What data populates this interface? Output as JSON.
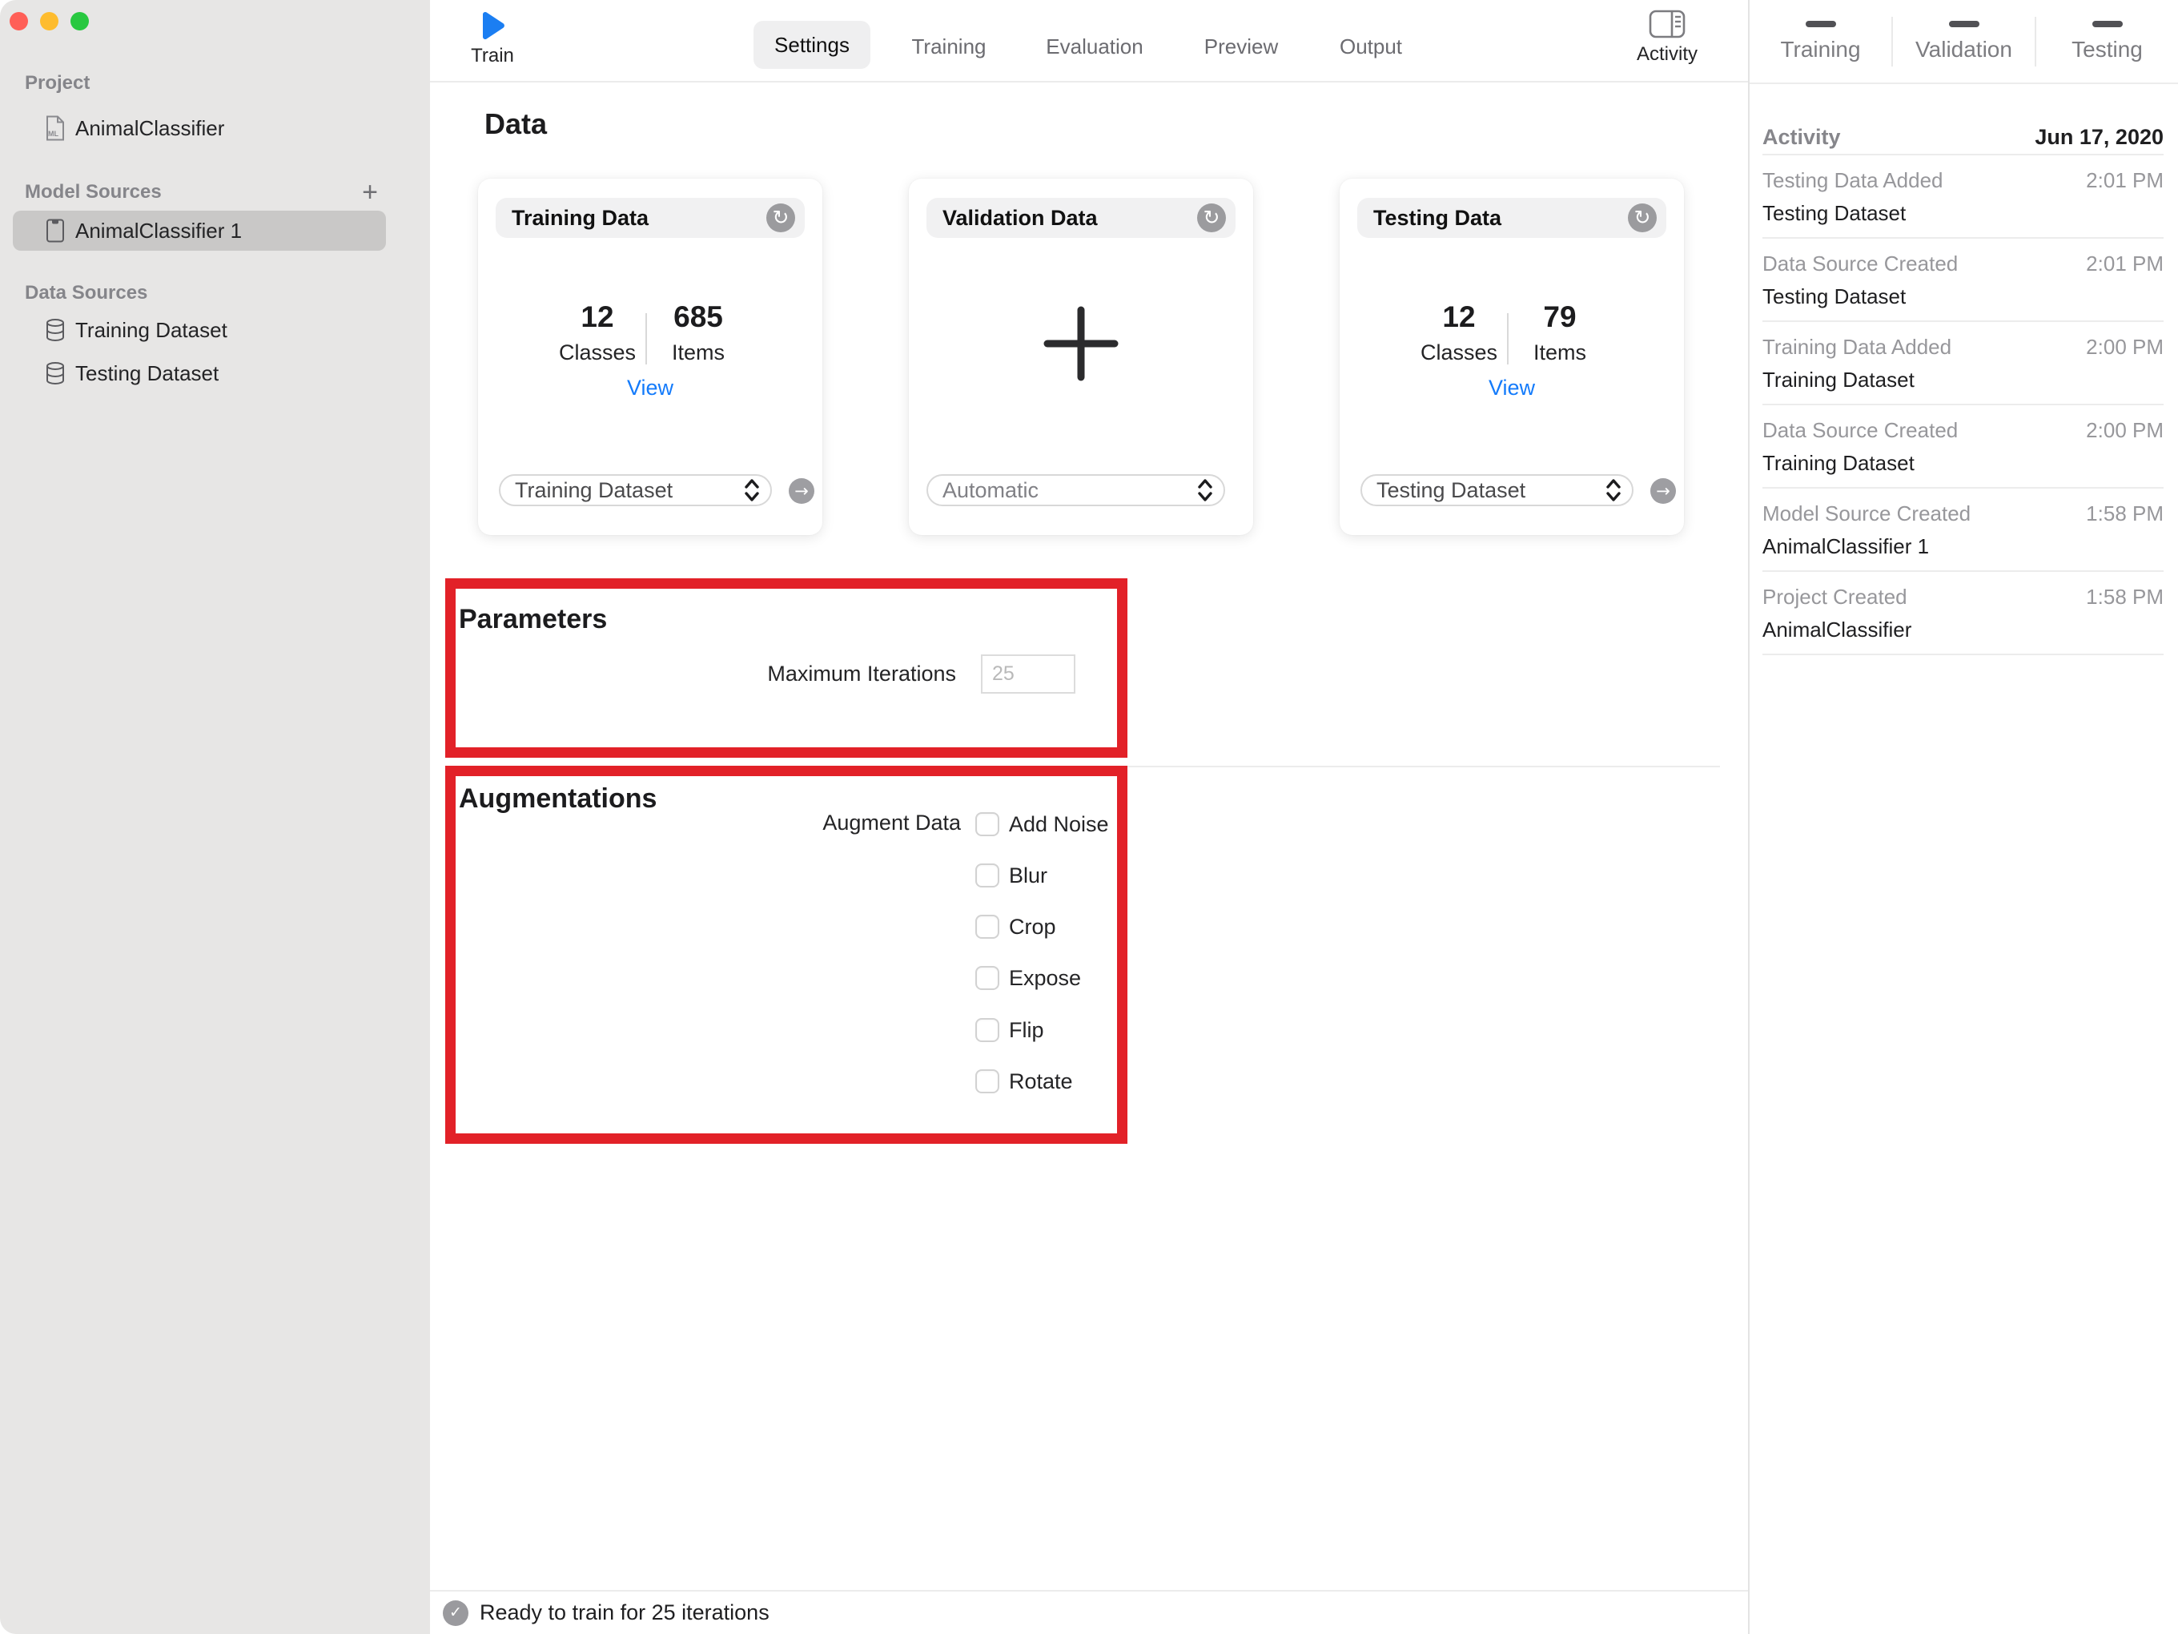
{
  "window": {
    "traffic_lights": [
      "close",
      "minimize",
      "zoom"
    ]
  },
  "sidebar": {
    "project_label": "Project",
    "project_item": "AnimalClassifier",
    "model_sources_label": "Model Sources",
    "add_button": "+",
    "model_source_item": "AnimalClassifier 1",
    "data_sources_label": "Data Sources",
    "data_source_items": [
      "Training Dataset",
      "Testing Dataset"
    ]
  },
  "toolbar": {
    "train_label": "Train",
    "tabs": [
      "Settings",
      "Training",
      "Evaluation",
      "Preview",
      "Output"
    ],
    "selected_tab": "Settings",
    "activity_label": "Activity"
  },
  "main": {
    "heading": "Data",
    "cards": {
      "training": {
        "title": "Training Data",
        "classes_value": "12",
        "classes_label": "Classes",
        "items_value": "685",
        "items_label": "Items",
        "view_label": "View",
        "dropdown_value": "Training Dataset"
      },
      "validation": {
        "title": "Validation Data",
        "dropdown_value": "Automatic"
      },
      "testing": {
        "title": "Testing Data",
        "classes_value": "12",
        "classes_label": "Classes",
        "items_value": "79",
        "items_label": "Items",
        "view_label": "View",
        "dropdown_value": "Testing Dataset"
      }
    },
    "parameters": {
      "heading": "Parameters",
      "max_iterations_label": "Maximum Iterations",
      "max_iterations_value": "25"
    },
    "augmentations": {
      "heading": "Augmentations",
      "augment_data_label": "Augment Data",
      "options": [
        "Add Noise",
        "Blur",
        "Crop",
        "Expose",
        "Flip",
        "Rotate"
      ]
    },
    "status_bar": {
      "text": "Ready to train for 25 iterations"
    }
  },
  "right_panel": {
    "stats": [
      {
        "value": "–",
        "label": "Training"
      },
      {
        "value": "–",
        "label": "Validation"
      },
      {
        "value": "–",
        "label": "Testing"
      }
    ],
    "activity": {
      "title": "Activity",
      "date": "Jun 17, 2020",
      "entries": [
        {
          "title": "Testing Data Added",
          "time": "2:01 PM",
          "subtitle": "Testing Dataset"
        },
        {
          "title": "Data Source Created",
          "time": "2:01 PM",
          "subtitle": "Testing Dataset"
        },
        {
          "title": "Training Data Added",
          "time": "2:00 PM",
          "subtitle": "Training Dataset"
        },
        {
          "title": "Data Source Created",
          "time": "2:00 PM",
          "subtitle": "Training Dataset"
        },
        {
          "title": "Model Source Created",
          "time": "1:58 PM",
          "subtitle": "AnimalClassifier 1"
        },
        {
          "title": "Project Created",
          "time": "1:58 PM",
          "subtitle": "AnimalClassifier"
        }
      ]
    }
  },
  "icons": {
    "refresh_glyph": "↻",
    "go_glyph": "→",
    "check_glyph": "✓"
  },
  "colors": {
    "accent_blue": "#147bfb",
    "annotation_red": "#e22128",
    "sidebar_bg": "#e7e6e5",
    "selected_row_bg": "#c9c8c7"
  }
}
